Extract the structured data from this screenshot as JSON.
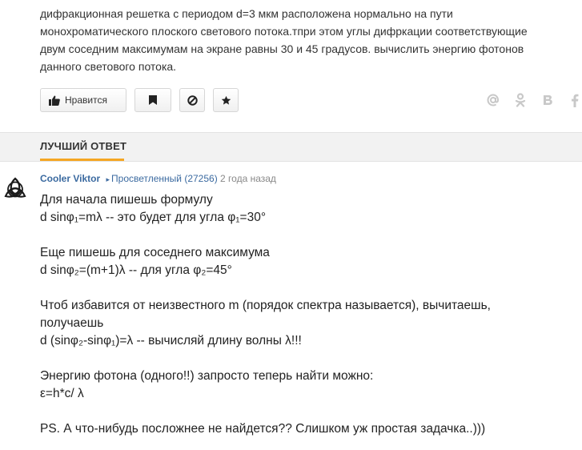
{
  "question": {
    "lines": [
      "дифракционная решетка с периодом d=3 мкм расположена нормально на пути",
      "монохроматического плоского светового потока.тпри этом углы дифркации соответствующие",
      "двум соседним максимумам на экране равны 30 и 45 градусов. вычислить энергию фотонов",
      "данного светового потока."
    ]
  },
  "actions": {
    "like_label": "Нравится",
    "like_icon": "thumbs-up-icon",
    "bookmark_icon": "flag-icon",
    "block_icon": "block-icon",
    "favorite_icon": "star-icon"
  },
  "share": {
    "icons": [
      "mail-at-icon",
      "odnoklassniki-icon",
      "vkontakte-icon",
      "facebook-icon"
    ],
    "color": "#c8c8c8"
  },
  "best_answer": {
    "label": "ЛУЧШИЙ ОТВЕТ",
    "accent": "#f5a623",
    "author": "Cooler Viktor",
    "rank": "Просветленный (27256)",
    "time_ago": "2 года назад",
    "avatar_icon": "triquetra-icon",
    "lines": [
      "Для начала пишешь формулу",
      "d sinφ₁=mλ -- это будет для угла φ₁=30°",
      "",
      "Еще пишешь для соседнего максимума",
      "d sinφ₂=(m+1)λ -- для угла φ₂=45°",
      "",
      "Чтоб избавится от неизвестного m (порядок спектра называется), вычитаешь,",
      "получаешь",
      "d (sinφ₂-sinφ₁)=λ -- вычисляй длину волны λ!!!",
      "",
      "Энергию фотона (одного!!) запросто теперь найти можно:",
      "ε=h*c/ λ",
      "",
      "PS. А что-нибудь посложнее не найдется?? Слишком уж простая задачка..)))"
    ]
  }
}
